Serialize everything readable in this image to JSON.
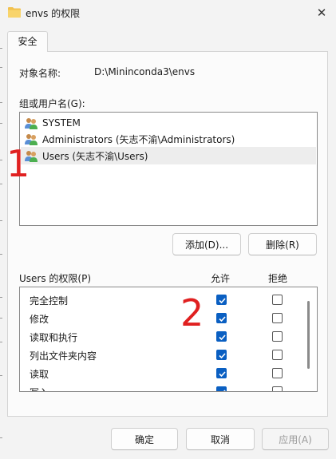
{
  "window": {
    "title": "envs 的权限",
    "close_glyph": "✕"
  },
  "tabs": [
    {
      "label": "安全"
    }
  ],
  "object": {
    "label": "对象名称:",
    "value": "D:\\Mininconda3\\envs"
  },
  "groups": {
    "label": "组或用户名(G):",
    "items": [
      {
        "name": "SYSTEM",
        "icon": "users-group-icon",
        "selected": false
      },
      {
        "name": "Administrators (矢志不渝\\Administrators)",
        "icon": "users-group-icon",
        "selected": false
      },
      {
        "name": "Users (矢志不渝\\Users)",
        "icon": "users-group-icon",
        "selected": true
      }
    ]
  },
  "buttons": {
    "add": "添加(D)...",
    "remove": "删除(R)"
  },
  "permissions": {
    "header": "Users 的权限(P)",
    "allow_label": "允许",
    "deny_label": "拒绝",
    "rows": [
      {
        "name": "完全控制",
        "allow": true,
        "deny": false
      },
      {
        "name": "修改",
        "allow": true,
        "deny": false
      },
      {
        "name": "读取和执行",
        "allow": true,
        "deny": false
      },
      {
        "name": "列出文件夹内容",
        "allow": true,
        "deny": false
      },
      {
        "name": "读取",
        "allow": true,
        "deny": false
      },
      {
        "name": "写入",
        "allow": true,
        "deny": false
      }
    ]
  },
  "footer": {
    "ok": "确定",
    "cancel": "取消",
    "apply": "应用(A)"
  },
  "annotations": [
    "1",
    "2"
  ],
  "colors": {
    "accent": "#0a5fc2",
    "annotation": "#e02020",
    "folder": "#f2c14e"
  }
}
